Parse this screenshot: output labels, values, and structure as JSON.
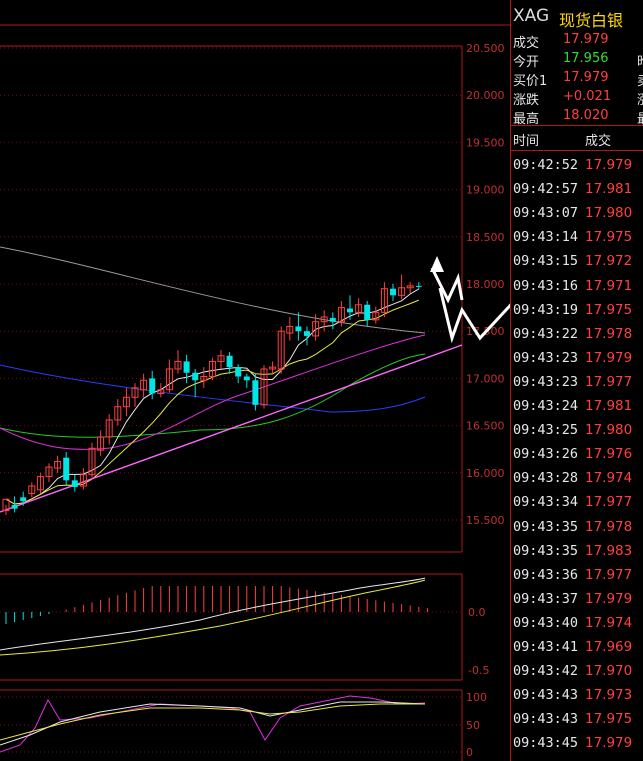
{
  "quote_panel": {
    "symbol": "XAG",
    "name": "现货白银",
    "rows": [
      {
        "label": "成交",
        "value": "17.979",
        "color": "#ff4040"
      },
      {
        "label": "今开",
        "value": "17.956",
        "color": "#33dd33"
      },
      {
        "label": "买价1",
        "value": "17.979",
        "color": "#ff4040"
      },
      {
        "label": "涨跌",
        "value": "+0.021",
        "color": "#ff4040"
      },
      {
        "label": "最高",
        "value": "18.020",
        "color": "#ff4040"
      }
    ],
    "truncated_labels": [
      "昨",
      "卖",
      "涨",
      "最"
    ]
  },
  "ticks": {
    "headers": {
      "time": "时间",
      "price": "成交"
    },
    "rows": [
      {
        "time": "09:42:52",
        "price": "17.979"
      },
      {
        "time": "09:42:57",
        "price": "17.981"
      },
      {
        "time": "09:43:07",
        "price": "17.980"
      },
      {
        "time": "09:43:14",
        "price": "17.975"
      },
      {
        "time": "09:43:15",
        "price": "17.972"
      },
      {
        "time": "09:43:16",
        "price": "17.971"
      },
      {
        "time": "09:43:19",
        "price": "17.975"
      },
      {
        "time": "09:43:22",
        "price": "17.978"
      },
      {
        "time": "09:43:23",
        "price": "17.979"
      },
      {
        "time": "09:43:23",
        "price": "17.977"
      },
      {
        "time": "09:43:24",
        "price": "17.981"
      },
      {
        "time": "09:43:25",
        "price": "17.980"
      },
      {
        "time": "09:43:26",
        "price": "17.976"
      },
      {
        "time": "09:43:28",
        "price": "17.974"
      },
      {
        "time": "09:43:34",
        "price": "17.977"
      },
      {
        "time": "09:43:35",
        "price": "17.978"
      },
      {
        "time": "09:43:35",
        "price": "17.983"
      },
      {
        "time": "09:43:36",
        "price": "17.977"
      },
      {
        "time": "09:43:37",
        "price": "17.979"
      },
      {
        "time": "09:43:40",
        "price": "17.974"
      },
      {
        "time": "09:43:41",
        "price": "17.969"
      },
      {
        "time": "09:43:42",
        "price": "17.970"
      },
      {
        "time": "09:43:43",
        "price": "17.973"
      },
      {
        "time": "09:43:43",
        "price": "17.975"
      },
      {
        "time": "09:43:45",
        "price": "17.979"
      }
    ]
  },
  "price_axis": [
    "20.500",
    "20.000",
    "19.500",
    "19.000",
    "18.500",
    "18.000",
    "17.500",
    "17.000",
    "16.500",
    "16.000",
    "15.500"
  ],
  "macd_axis": [
    "0.0",
    "-0.5"
  ],
  "kdj_axis": [
    "100",
    "50",
    "0"
  ],
  "colors": {
    "up": "#ff4040",
    "down": "#00e5e5",
    "grid": "#7a0e0e",
    "frame": "#b01818"
  },
  "chart_data": {
    "type": "candlestick",
    "y_range": [
      15.3,
      20.6
    ],
    "candles": [
      [
        15.6,
        15.72,
        15.55,
        15.66
      ],
      [
        15.66,
        15.62,
        15.58,
        15.75
      ],
      [
        15.74,
        15.7,
        15.65,
        15.8
      ],
      [
        15.78,
        15.86,
        15.74,
        15.9
      ],
      [
        15.82,
        15.96,
        15.78,
        16.0
      ],
      [
        15.96,
        16.06,
        15.9,
        16.1
      ],
      [
        16.05,
        16.12,
        16.0,
        16.18
      ],
      [
        16.16,
        15.92,
        15.86,
        16.22
      ],
      [
        15.92,
        15.85,
        15.8,
        15.98
      ],
      [
        15.86,
        15.98,
        15.82,
        16.05
      ],
      [
        15.98,
        16.26,
        15.95,
        16.32
      ],
      [
        16.24,
        16.38,
        16.18,
        16.45
      ],
      [
        16.38,
        16.56,
        16.3,
        16.62
      ],
      [
        16.56,
        16.7,
        16.5,
        16.78
      ],
      [
        16.7,
        16.8,
        16.6,
        16.9
      ],
      [
        16.8,
        16.9,
        16.7,
        16.95
      ],
      [
        16.88,
        16.98,
        16.8,
        17.05
      ],
      [
        17.0,
        16.84,
        16.78,
        17.08
      ],
      [
        16.84,
        16.88,
        16.8,
        16.95
      ],
      [
        16.88,
        17.1,
        16.85,
        17.2
      ],
      [
        17.1,
        17.18,
        17.05,
        17.3
      ],
      [
        17.18,
        17.06,
        16.95,
        17.25
      ],
      [
        17.06,
        16.98,
        16.8,
        17.1
      ],
      [
        16.98,
        17.02,
        16.9,
        17.12
      ],
      [
        17.02,
        17.18,
        16.98,
        17.22
      ],
      [
        17.18,
        17.24,
        17.1,
        17.3
      ],
      [
        17.24,
        17.12,
        17.05,
        17.28
      ],
      [
        17.12,
        17.02,
        16.95,
        17.15
      ],
      [
        17.02,
        16.98,
        16.9,
        17.05
      ],
      [
        16.98,
        16.72,
        16.66,
        17.05
      ],
      [
        16.72,
        17.1,
        16.68,
        17.14
      ],
      [
        17.1,
        17.12,
        17.05,
        17.18
      ],
      [
        17.1,
        17.5,
        17.05,
        17.55
      ],
      [
        17.48,
        17.55,
        17.4,
        17.65
      ],
      [
        17.55,
        17.5,
        17.4,
        17.7
      ],
      [
        17.5,
        17.45,
        17.35,
        17.55
      ],
      [
        17.45,
        17.6,
        17.4,
        17.68
      ],
      [
        17.6,
        17.65,
        17.5,
        17.72
      ],
      [
        17.64,
        17.6,
        17.52,
        17.7
      ],
      [
        17.6,
        17.75,
        17.55,
        17.82
      ],
      [
        17.74,
        17.7,
        17.62,
        17.88
      ],
      [
        17.7,
        17.78,
        17.65,
        17.85
      ],
      [
        17.78,
        17.62,
        17.55,
        17.82
      ],
      [
        17.62,
        17.7,
        17.58,
        17.76
      ],
      [
        17.7,
        17.95,
        17.65,
        18.02
      ],
      [
        17.95,
        17.88,
        17.82,
        18.0
      ],
      [
        17.88,
        17.96,
        17.84,
        18.1
      ],
      [
        17.96,
        17.98,
        17.9,
        18.02
      ],
      [
        17.98,
        17.97,
        17.94,
        18.02
      ]
    ]
  }
}
